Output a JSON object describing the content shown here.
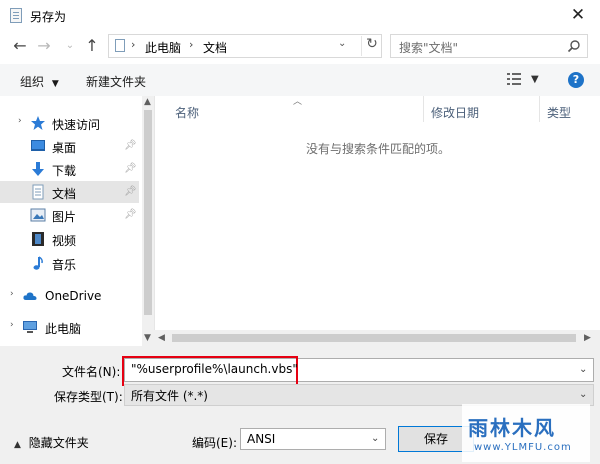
{
  "window": {
    "title": "另存为",
    "close": "✕"
  },
  "address": {
    "crumbs": [
      "此电脑",
      "文档"
    ],
    "refresh": "↻",
    "search_placeholder": "搜索\"文档\""
  },
  "toolbar": {
    "organize": "组织",
    "new_folder": "新建文件夹",
    "help": "?"
  },
  "sidebar": {
    "items": [
      {
        "label": "快速访问",
        "icon": "star-icon"
      },
      {
        "label": "桌面",
        "icon": "desktop-icon",
        "pinned": true
      },
      {
        "label": "下载",
        "icon": "download-icon",
        "pinned": true
      },
      {
        "label": "文档",
        "icon": "document-icon",
        "pinned": true,
        "selected": true
      },
      {
        "label": "图片",
        "icon": "pictures-icon",
        "pinned": true
      },
      {
        "label": "视频",
        "icon": "video-icon"
      },
      {
        "label": "音乐",
        "icon": "music-icon"
      },
      {
        "label": "OneDrive",
        "icon": "cloud-icon"
      },
      {
        "label": "此电脑",
        "icon": "computer-icon"
      }
    ]
  },
  "file_list": {
    "columns": [
      "名称",
      "修改日期",
      "类型"
    ],
    "empty_message": "没有与搜索条件匹配的项。"
  },
  "form": {
    "filename_label": "文件名(N):",
    "filename_value": "\"%userprofile%\\launch.vbs\"",
    "filetype_label": "保存类型(T):",
    "filetype_value": "所有文件  (*.*)",
    "encoding_label": "编码(E):",
    "encoding_value": "ANSI",
    "hide_folders": "隐藏文件夹",
    "save_button": "保存"
  },
  "watermark": {
    "text": "雨林木风",
    "url": "www.YLMFU.com"
  },
  "colors": {
    "accent": "#1e73c8",
    "highlight": "#e60012",
    "selected": "#e5e5e5"
  }
}
